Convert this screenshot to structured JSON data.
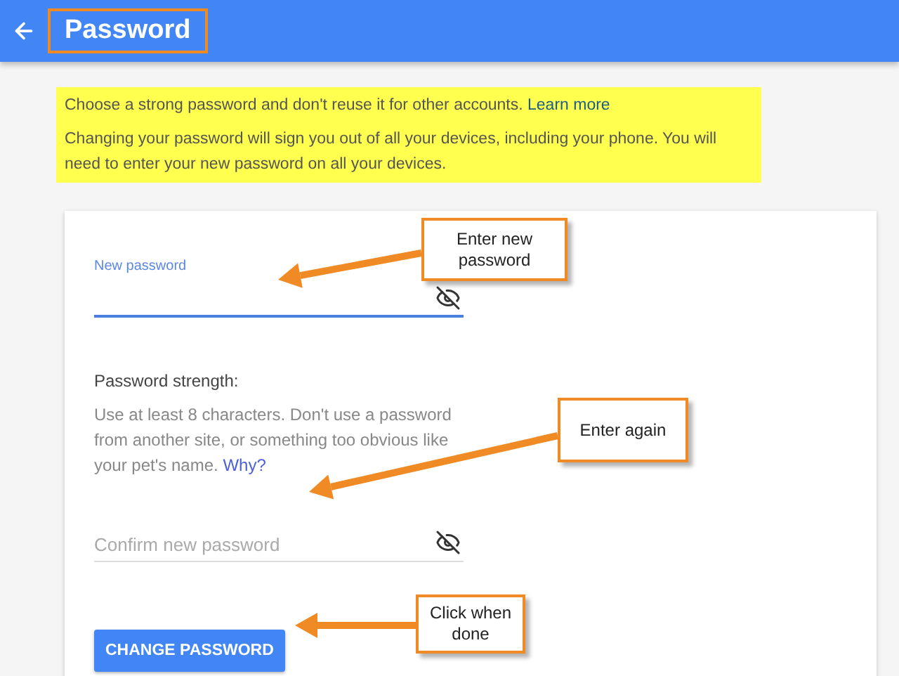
{
  "header": {
    "title": "Password",
    "highlighted": true
  },
  "notice": {
    "line1": "Choose a strong password and don't reuse it for other accounts.",
    "link": "Learn more",
    "line2": "Changing your password will sign you out of all your devices, including your phone. You will need to enter your new password on all your devices."
  },
  "fields": [
    {
      "label": "New password",
      "focused": true
    },
    {
      "placeholder": "Confirm new password",
      "focused": false
    }
  ],
  "strength": {
    "title": "Password strength:",
    "hint": "Use at least 8 characters. Don't use a password from another site, or something too obvious like your pet's name.",
    "link": "Why?"
  },
  "button": "CHANGE PASSWORD",
  "callouts": [
    {
      "text": "Enter new password"
    },
    {
      "text": "Enter again"
    },
    {
      "text": "Click when done"
    }
  ]
}
